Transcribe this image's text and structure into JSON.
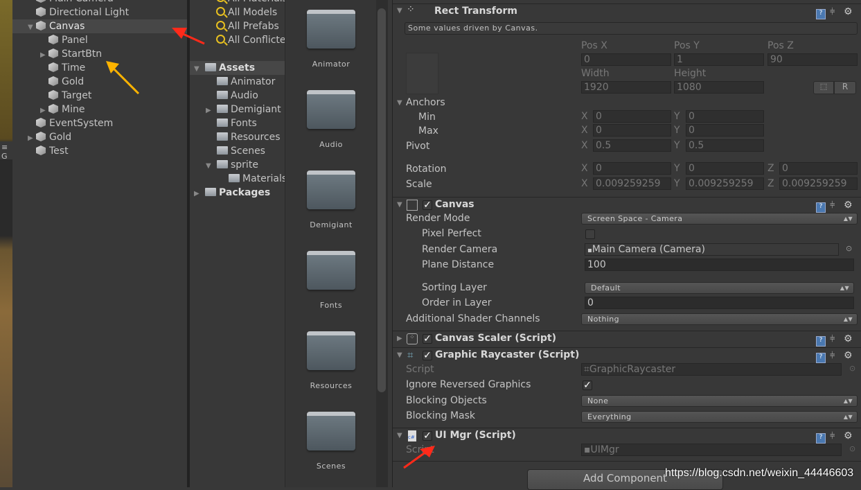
{
  "hierarchy": {
    "items": [
      {
        "label": "Main Camera",
        "depth": 0,
        "arrow": "none",
        "selected": false
      },
      {
        "label": "Directional Light",
        "depth": 0,
        "arrow": "none",
        "selected": false
      },
      {
        "label": "Canvas",
        "depth": 0,
        "arrow": "down",
        "selected": true
      },
      {
        "label": "Panel",
        "depth": 1,
        "arrow": "none",
        "selected": false
      },
      {
        "label": "StartBtn",
        "depth": 1,
        "arrow": "right",
        "selected": false
      },
      {
        "label": "Time",
        "depth": 1,
        "arrow": "none",
        "selected": false
      },
      {
        "label": "Gold",
        "depth": 1,
        "arrow": "none",
        "selected": false
      },
      {
        "label": "Target",
        "depth": 1,
        "arrow": "none",
        "selected": false
      },
      {
        "label": "Mine",
        "depth": 1,
        "arrow": "right",
        "selected": false
      },
      {
        "label": "EventSystem",
        "depth": 0,
        "arrow": "none",
        "selected": false
      },
      {
        "label": "Gold",
        "depth": 0,
        "arrow": "right",
        "selected": false
      },
      {
        "label": "Test",
        "depth": 0,
        "arrow": "none",
        "selected": false
      }
    ]
  },
  "scene_tab_letter": "G",
  "project": {
    "favorites": [
      "All Materials",
      "All Models",
      "All Prefabs",
      "All Conflicted"
    ],
    "tree": [
      {
        "label": "Assets",
        "depth": 0,
        "arrow": "down",
        "bold": true
      },
      {
        "label": "Animator",
        "depth": 1,
        "arrow": "none"
      },
      {
        "label": "Audio",
        "depth": 1,
        "arrow": "none"
      },
      {
        "label": "Demigiant",
        "depth": 1,
        "arrow": "right"
      },
      {
        "label": "Fonts",
        "depth": 1,
        "arrow": "none"
      },
      {
        "label": "Resources",
        "depth": 1,
        "arrow": "none"
      },
      {
        "label": "Scenes",
        "depth": 1,
        "arrow": "none"
      },
      {
        "label": "sprite",
        "depth": 1,
        "arrow": "down"
      },
      {
        "label": "Materials",
        "depth": 2,
        "arrow": "none"
      },
      {
        "label": "Packages",
        "depth": 0,
        "arrow": "right",
        "bold": true
      }
    ],
    "grid": [
      "Animator",
      "Audio",
      "Demigiant",
      "Fonts",
      "Resources",
      "Scenes"
    ]
  },
  "inspector": {
    "rect": {
      "title": "Rect Transform",
      "note": "Some values driven by Canvas.",
      "posx_l": "Pos X",
      "posy_l": "Pos Y",
      "posz_l": "Pos Z",
      "posx": "0",
      "posy": "1",
      "posz": "90",
      "width_l": "Width",
      "height_l": "Height",
      "width": "1920",
      "height": "1080",
      "r_btn": "R",
      "anchors": "Anchors",
      "min": "Min",
      "max": "Max",
      "pivot": "Pivot",
      "rotation": "Rotation",
      "scale": "Scale",
      "X": "X",
      "Y": "Y",
      "Z": "Z",
      "minx": "0",
      "miny": "0",
      "maxx": "0",
      "maxy": "0",
      "pivx": "0.5",
      "pivy": "0.5",
      "rotx": "0",
      "roty": "0",
      "rotz": "0",
      "scx": "0.009259259",
      "scy": "0.009259259",
      "scz": "0.009259259"
    },
    "canvas": {
      "title": "Canvas",
      "enabled": true,
      "render_mode_l": "Render Mode",
      "render_mode": "Screen Space - Camera",
      "pixel_perfect_l": "Pixel Perfect",
      "pixel_perfect": false,
      "render_camera_l": "Render Camera",
      "render_camera": "Main Camera (Camera)",
      "plane_distance_l": "Plane Distance",
      "plane_distance": "100",
      "sorting_layer_l": "Sorting Layer",
      "sorting_layer": "Default",
      "order_l": "Order in Layer",
      "order": "0",
      "shader_l": "Additional Shader Channels",
      "shader": "Nothing"
    },
    "scaler": {
      "title": "Canvas Scaler (Script)",
      "enabled": true
    },
    "raycaster": {
      "title": "Graphic Raycaster (Script)",
      "enabled": true,
      "script_l": "Script",
      "script": "GraphicRaycaster",
      "ignore_l": "Ignore Reversed Graphics",
      "ignore": true,
      "blocking_objects_l": "Blocking Objects",
      "blocking_objects": "None",
      "blocking_mask_l": "Blocking Mask",
      "blocking_mask": "Everything"
    },
    "uimgr": {
      "title": "UI Mgr (Script)",
      "enabled": true,
      "script_l": "Script",
      "script": "UIMgr"
    },
    "add_component": "Add Component"
  },
  "watermark": "https://blog.csdn.net/weixin_44446603",
  "colors": {
    "annotation_red": "#ff2a1a",
    "annotation_yellow": "#ffb400"
  }
}
